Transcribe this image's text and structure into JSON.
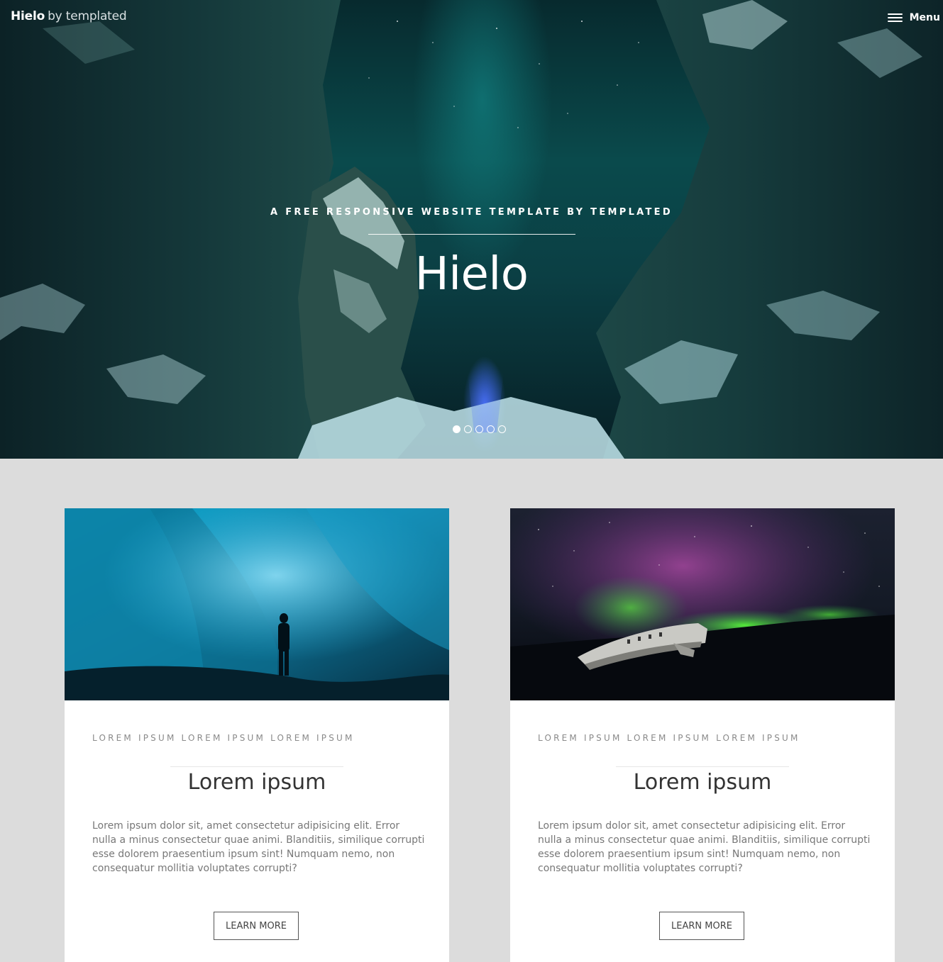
{
  "header": {
    "brand": "Hielo",
    "by_text": "by templated",
    "menu_label": "Menu"
  },
  "hero": {
    "tagline": "A free responsive website template by Templated",
    "title": "Hielo",
    "slides": {
      "count": 5,
      "active_index": 0
    }
  },
  "cards": [
    {
      "eyebrow": "Lorem ipsum lorem ipsum lorem ipsum",
      "title": "Lorem ipsum",
      "text": "Lorem ipsum dolor sit, amet consectetur adipisicing elit. Error nulla a minus consectetur quae animi. Blanditiis, similique corrupti esse dolorem praesentium ipsum sint! Numquam nemo, non consequatur mollitia voluptates corrupti?",
      "button_label": "Learn More"
    },
    {
      "eyebrow": "Lorem ipsum lorem ipsum lorem ipsum",
      "title": "Lorem ipsum",
      "text": "Lorem ipsum dolor sit, amet consectetur adipisicing elit. Error nulla a minus consectetur quae animi. Blanditiis, similique corrupti esse dolorem praesentium ipsum sint! Numquam nemo, non consequatur mollitia voluptates corrupti?",
      "button_label": "Learn More"
    }
  ],
  "colors": {
    "page_background": "#dcdcdc",
    "card_background": "#ffffff",
    "hero_teal": "#0a4a4c",
    "text_dark": "#333333",
    "text_muted": "#777777"
  }
}
